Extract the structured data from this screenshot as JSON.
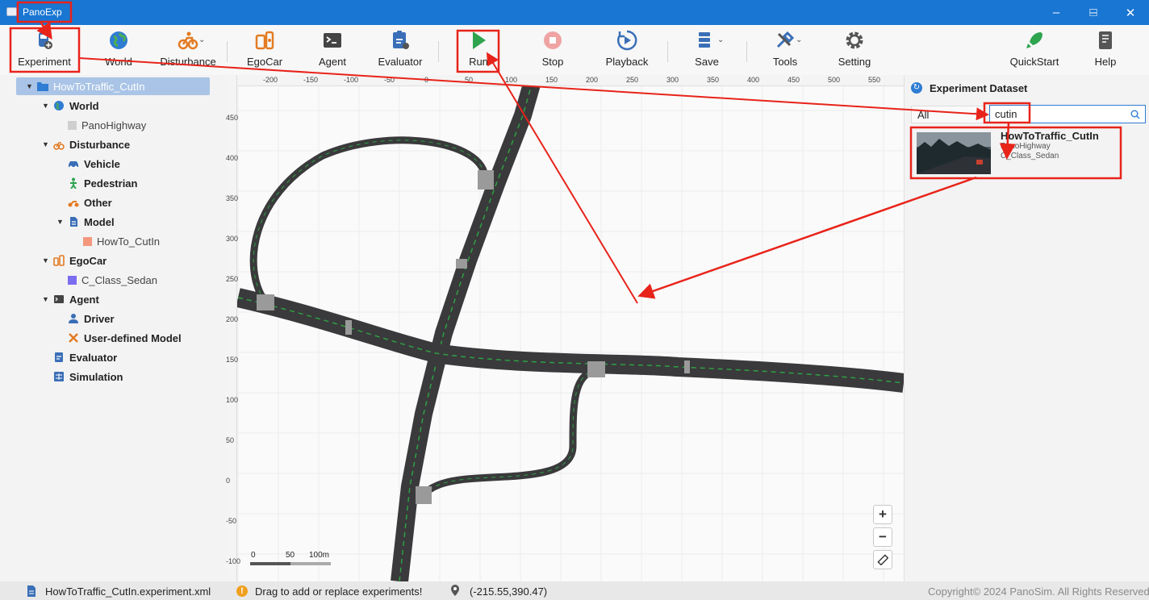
{
  "window": {
    "title": "PanoExp"
  },
  "toolbar": {
    "experiment": "Experiment",
    "world": "World",
    "disturbance": "Disturbance",
    "egocar": "EgoCar",
    "agent": "Agent",
    "evaluator": "Evaluator",
    "run": "Run",
    "stop": "Stop",
    "playback": "Playback",
    "save": "Save",
    "tools": "Tools",
    "setting": "Setting",
    "quickstart": "QuickStart",
    "help": "Help"
  },
  "tree": {
    "root": "HowToTraffic_CutIn",
    "world": "World",
    "world_map": "PanoHighway",
    "disturbance": "Disturbance",
    "vehicle": "Vehicle",
    "pedestrian": "Pedestrian",
    "other": "Other",
    "model": "Model",
    "model_item": "HowTo_CutIn",
    "egocar": "EgoCar",
    "egocar_item": "C_Class_Sedan",
    "agent": "Agent",
    "driver": "Driver",
    "user_model": "User-defined Model",
    "evaluator": "Evaluator",
    "simulation": "Simulation"
  },
  "map": {
    "x_ticks": [
      "-200",
      "-150",
      "-100",
      "-50",
      "0",
      "50",
      "100",
      "150",
      "200",
      "250",
      "300",
      "350",
      "400",
      "450",
      "500",
      "550"
    ],
    "y_ticks": [
      "450",
      "400",
      "350",
      "300",
      "250",
      "200",
      "150",
      "100",
      "50",
      "0",
      "-50",
      "-100"
    ],
    "scale_labels": [
      "0",
      "50",
      "100m"
    ],
    "zoom_in": "+",
    "zoom_out": "−"
  },
  "dataset": {
    "title": "Experiment Dataset",
    "filter": "All",
    "search_value": "cutin",
    "card": {
      "title": "HowToTraffic_CutIn",
      "world": "PanoHighway",
      "car": "C_Class_Sedan"
    }
  },
  "status": {
    "file": "HowToTraffic_CutIn.experiment.xml",
    "hint": "Drag to add or replace experiments!",
    "coords": "(-215.55,390.47)",
    "copyright": "Copyright© 2024 PanoSim. All Rights Reserved"
  },
  "colors": {
    "titlebar": "#1976d2",
    "selection": "#a9c4e6",
    "annotation": "#e8231a",
    "road": "#3a3a3c",
    "lane_center": "#2ea043"
  }
}
